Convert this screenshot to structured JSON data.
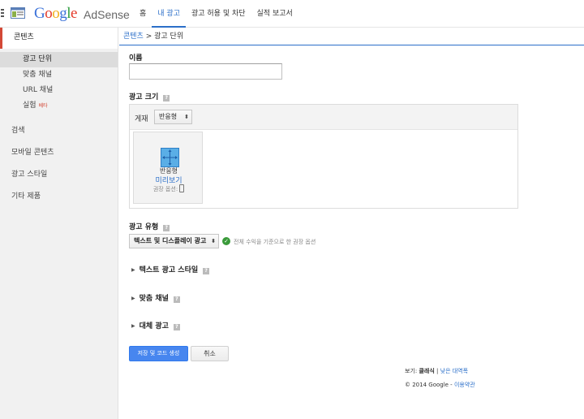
{
  "brand": {
    "logo_letters": [
      "G",
      "o",
      "o",
      "g",
      "l",
      "e"
    ],
    "product": "AdSense"
  },
  "topnav": {
    "items": [
      {
        "label": "홈"
      },
      {
        "label": "내 광고"
      },
      {
        "label": "광고 허용 및 차단"
      },
      {
        "label": "실적 보고서"
      }
    ],
    "active_index": 1
  },
  "sidebar": {
    "section": "콘텐츠",
    "sub_items": [
      {
        "label": "광고 단위"
      },
      {
        "label": "맞춤 채널"
      },
      {
        "label": "URL 채널"
      },
      {
        "label": "실험",
        "badge": "베타"
      }
    ],
    "top_items": [
      {
        "label": "검색"
      },
      {
        "label": "모바일 콘텐츠"
      },
      {
        "label": "광고 스타일"
      },
      {
        "label": "기타 제품"
      }
    ]
  },
  "breadcrumb": {
    "link": "콘텐츠",
    "separator": ">",
    "current": "광고 단위"
  },
  "form": {
    "name_label": "이름",
    "name_value": "",
    "size_label": "광고 크기",
    "size_help": "?",
    "display_label": "게재",
    "display_value": "반응형",
    "tile": {
      "title": "반응형",
      "preview_link": "미리보기",
      "recommended": "권장 옵션:"
    },
    "type_label": "광고 유형",
    "type_help": "?",
    "type_value": "텍스트 및 디스플레이 광고",
    "type_hint": "전체 수익을 기준으로 한 권장 옵션",
    "expanders": [
      {
        "label": "텍스트 광고 스타일",
        "help": "?"
      },
      {
        "label": "맞춤 채널",
        "help": "?"
      },
      {
        "label": "대체 광고",
        "help": "?"
      }
    ],
    "save_button": "저장 및 코드 생성",
    "cancel_button": "취소"
  },
  "footer": {
    "view_label": "보기:",
    "view_current": "클래식",
    "view_separator": "|",
    "view_alt": "낮은 대역폭",
    "copyright": "© 2014 Google -",
    "terms_link": "이용약관"
  },
  "colors": {
    "accent": "#2b6fc9",
    "sidebar_marker": "#d34836",
    "primary_button": "#4786ef",
    "check": "#3a9a3a"
  }
}
